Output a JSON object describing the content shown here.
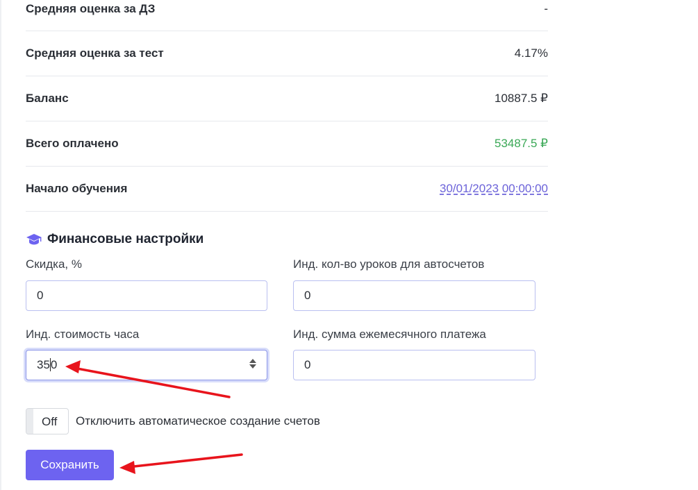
{
  "summary": {
    "rows": [
      {
        "label": "Средняя оценка за ДЗ",
        "value": "-"
      },
      {
        "label": "Средняя оценка за тест",
        "value": "4.17%"
      },
      {
        "label": "Баланс",
        "value": "10887.5 ₽"
      },
      {
        "label": "Всего оплачено",
        "value": "53487.5 ₽"
      },
      {
        "label": "Начало обучения",
        "value": "30/01/2023 00:00:00"
      }
    ]
  },
  "finance": {
    "title": "Финансовые настройки",
    "icon": "graduation-cap-icon",
    "discount": {
      "label": "Скидка, %",
      "value": "0"
    },
    "lessons_count": {
      "label": "Инд. кол-во уроков для автосчетов",
      "value": "0"
    },
    "hourly_rate": {
      "label": "Инд. стоимость часа",
      "value_before_caret": "35",
      "value_after_caret": "0"
    },
    "monthly_payment": {
      "label": "Инд. сумма ежемесячного платежа",
      "value": "0"
    },
    "toggle": {
      "state": "Off",
      "label": "Отключить автоматическое создание счетов"
    },
    "save_label": "Сохранить"
  },
  "colors": {
    "accent": "#6d63f0",
    "paid_green": "#3aa856",
    "link": "#6c63d9",
    "annotation_arrow": "#e8141c"
  }
}
